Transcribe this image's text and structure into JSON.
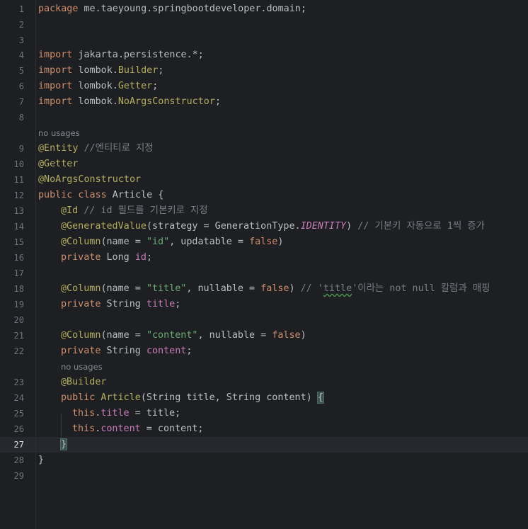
{
  "line_numbers": [
    "1",
    "2",
    "3",
    "4",
    "5",
    "6",
    "7",
    "8",
    "9",
    "10",
    "11",
    "12",
    "13",
    "14",
    "15",
    "16",
    "17",
    "18",
    "19",
    "20",
    "21",
    "22",
    "23",
    "24",
    "25",
    "26",
    "27",
    "28",
    "29"
  ],
  "current_line": "27",
  "hints": {
    "entity_usages": "no usages",
    "builder_usages": "no usages"
  },
  "code": {
    "l1_package": "package",
    "l1_name": " me.taeyoung.springbootdeveloper.domain;",
    "import_kw": "import",
    "l4_rest": " jakarta.persistence.*;",
    "l5_pkg": " lombok.",
    "l5_cls": "Builder",
    "l6_pkg": " lombok.",
    "l6_cls": "Getter",
    "l7_pkg": " lombok.",
    "l7_cls": "NoArgsConstructor",
    "semicolon": ";",
    "l9_ann": "@Entity",
    "l9_comment": " //엔티티로 지정",
    "l10_ann": "@Getter",
    "l11_ann": "@NoArgsConstructor",
    "l12_kw": "public class",
    "l12_rest": " Article {",
    "l13_ann": "@Id",
    "l13_comment": " // id 필드를 기본키로 지정",
    "l14_ann": "@GeneratedValue",
    "l14_a": "(strategy = GenerationType.",
    "l14_b": "IDENTITY",
    "l14_c": ")",
    "l14_comment": " // 기본키 자동으로 1씩 증가",
    "l15_ann": "@Column",
    "l15_a": "(name = ",
    "l15_str": "\"id\"",
    "l15_b": ", updatable = ",
    "l15_false": "false",
    "l15_c": ")",
    "l16_kw": "private",
    "l16_type": " Long ",
    "l16_field": "id",
    "l18_ann": "@Column",
    "l18_a": "(name = ",
    "l18_str": "\"title\"",
    "l18_b": ", nullable = ",
    "l18_false": "false",
    "l18_c": ") ",
    "l18_cm1": "// '",
    "l18_cm2": "title",
    "l18_cm3": "'이라는 not null 칼럼과 매핑",
    "l19_kw": "private",
    "l19_type": " String ",
    "l19_field": "title",
    "l21_ann": "@Column",
    "l21_a": "(name = ",
    "l21_str": "\"content\"",
    "l21_b": ", nullable = ",
    "l21_false": "false",
    "l21_c": ")",
    "l22_kw": "private",
    "l22_type": " String ",
    "l22_field": "content",
    "l23_ann": "@Builder",
    "l24_kw": "public",
    "l24_name": " Article",
    "l24_rest": "(String title, String content) ",
    "l24_brace": "{",
    "l25_this": "this",
    "l25_dot": ".",
    "l25_field": "title",
    "l25_rest": " = title;",
    "l26_this": "this",
    "l26_dot": ".",
    "l26_field": "content",
    "l26_rest": " = content;",
    "l27_brace": "}",
    "l28_brace": "}"
  },
  "colors": {
    "background": "#1e1f22",
    "keyword": "#cf8e6d",
    "annotation": "#b3ae60",
    "comment": "#7a7e85",
    "string": "#6aab73",
    "field": "#c77dbb",
    "text": "#bcbec4"
  }
}
